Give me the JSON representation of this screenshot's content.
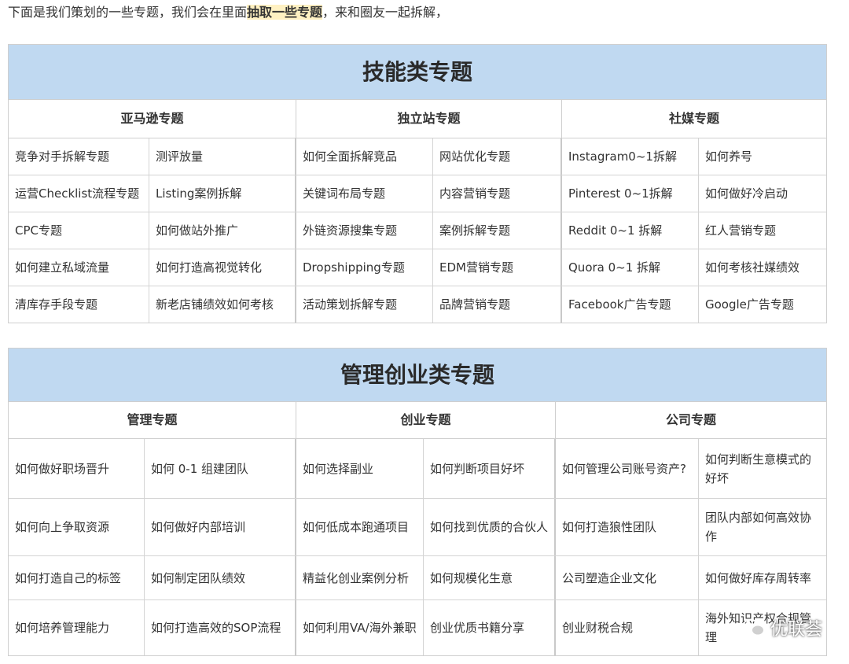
{
  "intro": {
    "before": "下面是我们策划的一些专题，我们会在里面",
    "highlight": "抽取一些专题",
    "after": "，来和圈友一起拆解，"
  },
  "skills": {
    "title": "技能类专题",
    "groups": [
      "亚马逊专题",
      "独立站专题",
      "社媒专题"
    ],
    "rows": [
      [
        "竞争对手拆解专题",
        "测评放量",
        "如何全面拆解竞品",
        "网站优化专题",
        "Instagram0~1拆解",
        "如何养号"
      ],
      [
        "运营Checklist流程专题",
        "Listing案例拆解",
        "关键词布局专题",
        "内容营销专题",
        "Pinterest 0~1拆解",
        "如何做好冷启动"
      ],
      [
        "CPC专题",
        "如何做站外推广",
        "外链资源搜集专题",
        "案例拆解专题",
        "Reddit 0~1 拆解",
        "红人营销专题"
      ],
      [
        "如何建立私域流量",
        "如何打造高视觉转化",
        "Dropshipping专题",
        "EDM营销专题",
        "Quora 0~1 拆解",
        "如何考核社媒绩效"
      ],
      [
        "清库存手段专题",
        "新老店铺绩效如何考核",
        "活动策划拆解专题",
        "品牌营销专题",
        "Facebook广告专题",
        "Google广告专题"
      ]
    ]
  },
  "mgmt": {
    "title": "管理创业类专题",
    "groups": [
      "管理专题",
      "创业专题",
      "公司专题"
    ],
    "rows": [
      [
        "如何做好职场晋升",
        "如何 0-1 组建团队",
        "如何选择副业",
        "如何判断项目好坏",
        "如何管理公司账号资产?",
        "如何判断生意模式的好坏"
      ],
      [
        "如何向上争取资源",
        "如何做好内部培训",
        "如何低成本跑通项目",
        "如何找到优质的合伙人",
        "如何打造狼性团队",
        "团队内部如何高效协作"
      ],
      [
        "如何打造自己的标签",
        "如何制定团队绩效",
        "精益化创业案例分析",
        "如何规模化生意",
        "公司塑造企业文化",
        "如何做好库存周转率"
      ],
      [
        "如何培养管理能力",
        "如何打造高效的SOP流程",
        "如何利用VA/海外兼职",
        "创业优质书籍分享",
        "创业财税合规",
        "海外知识产权合规管理"
      ]
    ]
  },
  "watermark": {
    "label": "优联荟",
    "icon": "wechat-icon"
  }
}
